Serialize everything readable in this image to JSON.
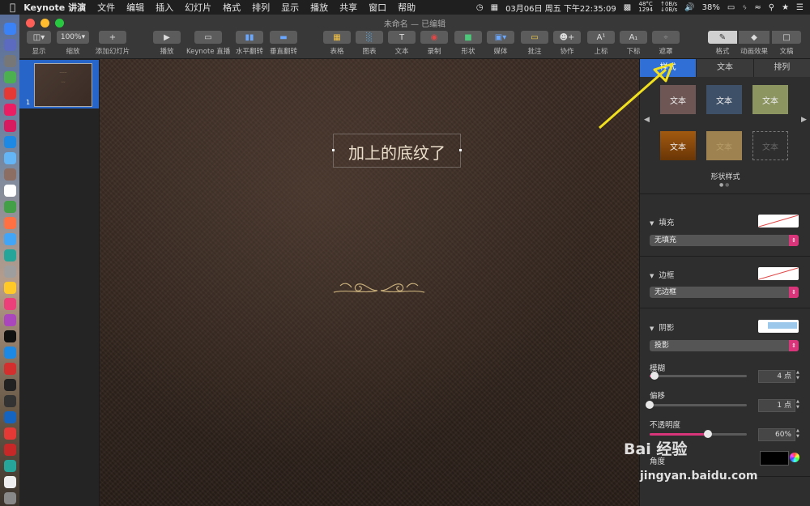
{
  "menubar": {
    "app": "Keynote 讲演",
    "items": [
      "文件",
      "编辑",
      "插入",
      "幻灯片",
      "格式",
      "排列",
      "显示",
      "播放",
      "共享",
      "窗口",
      "帮助"
    ],
    "datetime": "03月06日 周五 下午22:35:09",
    "temp": "48°C",
    "rpm": "1294",
    "net_up": "0B/s",
    "net_down": "0B/s",
    "battery": "38%"
  },
  "window": {
    "title": "未命名",
    "status": "— 已编辑"
  },
  "toolbar": {
    "view": "显示",
    "zoom_value": "100%",
    "zoom": "缩放",
    "add_slide": "添加幻灯片",
    "play": "播放",
    "keynote_live": "Keynote 直播",
    "flip_h": "水平翻转",
    "flip_v": "垂直翻转",
    "table": "表格",
    "chart": "图表",
    "text": "文本",
    "record": "录制",
    "shape": "形状",
    "media": "媒体",
    "comment": "批注",
    "collaborate": "协作",
    "superscript": "上标",
    "subscript": "下标",
    "mask": "遮罩",
    "format": "格式",
    "animate": "动画效果",
    "document": "文稿"
  },
  "navigator": {
    "slide_number": "1"
  },
  "slide": {
    "title": "加上的底纹了"
  },
  "inspector": {
    "tabs": [
      "样式",
      "文本",
      "排列"
    ],
    "style_swatches": [
      "文本",
      "文本",
      "文本",
      "文本",
      "文本",
      "文本"
    ],
    "shape_styles_label": "形状样式",
    "fill_label": "填充",
    "fill_value": "无填充",
    "border_label": "边框",
    "border_value": "无边框",
    "shadow_label": "阴影",
    "shadow_value": "投影",
    "blur_label": "模糊",
    "blur_value": "4 点",
    "offset_label": "偏移",
    "offset_value": "1 点",
    "opacity_label": "不透明度",
    "opacity_value": "60%",
    "angle_label": "角度",
    "blur_level": 0.05,
    "offset_level": 0.0,
    "opacity_level": 0.6
  },
  "colors": {
    "accent": "#2f6fd6",
    "popup_accent": "#d8357a",
    "annotation_arrow": "#f0e020"
  },
  "watermark": {
    "brand": "Bai 经验",
    "url": "jingyan.baidu.com"
  }
}
